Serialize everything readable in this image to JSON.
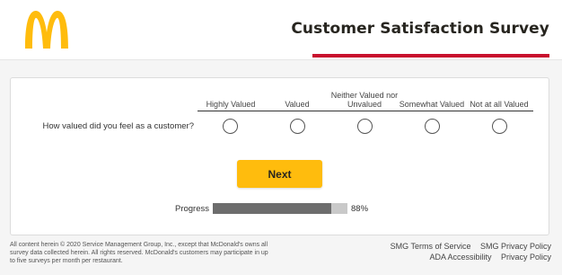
{
  "header": {
    "title": "Customer Satisfaction Survey",
    "logo_icon": "golden-arches-icon",
    "accent_color": "#c8102e",
    "logo_color": "#ffbc0d"
  },
  "survey": {
    "columns": [
      "Highly Valued",
      "Valued",
      "Neither Valued nor Unvalued",
      "Somewhat Valued",
      "Not at all Valued"
    ],
    "question": "How valued did you feel as a customer?",
    "next_label": "Next",
    "next_color": "#ffbc0d"
  },
  "progress": {
    "label": "Progress",
    "value_text": "88%",
    "fraction": 0.88
  },
  "footer": {
    "copyright": "All content herein © 2020 Service Management Group, Inc., except that McDonald's owns all survey data collected herein. All rights reserved. McDonald's customers may participate in up to five surveys per month per restaurant.",
    "links": [
      "SMG Terms of Service",
      "SMG Privacy Policy",
      "ADA Accessibility",
      "Privacy Policy"
    ]
  }
}
